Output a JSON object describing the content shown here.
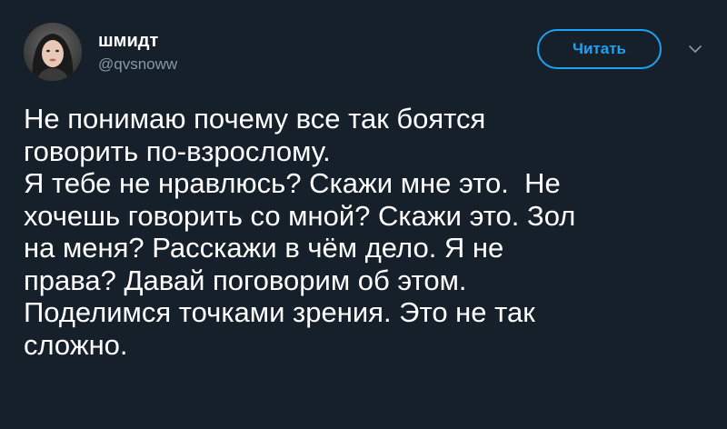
{
  "user": {
    "display_name": "шмидт",
    "handle": "@qvsnoww"
  },
  "actions": {
    "follow_label": "Читать"
  },
  "icons": {
    "avatar": "user-avatar-photo",
    "caret": "chevron-down-icon"
  },
  "tweet": {
    "text": "Не понимаю почему все так боятся\nговорить по-взрослому.\nЯ тебе не нравлюсь? Скажи мне это.  Не\nхочешь говорить со мной? Скажи это. Зол\nна меня? Расскажи в чём дело. Я не\nправа? Давай поговорим об этом.\nПоделимся точками зрения. Это не так\nсложно."
  },
  "colors": {
    "background": "#15202b",
    "accent": "#1da1f2",
    "secondary_text": "#8899a6",
    "primary_text": "#ffffff"
  }
}
